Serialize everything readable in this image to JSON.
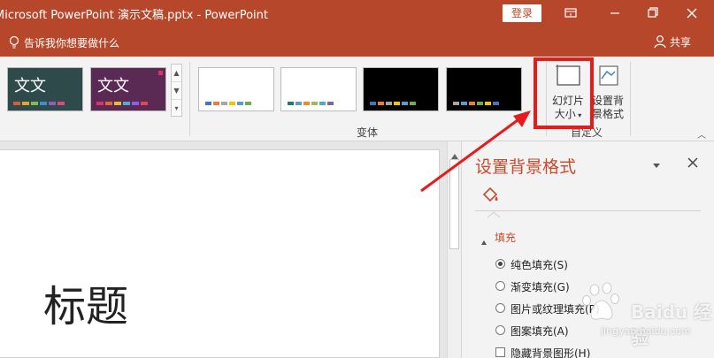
{
  "titlebar": {
    "title": "Microsoft PowerPoint 演示文稿.pptx  -  PowerPoint",
    "login_label": "登录",
    "background": "#b7472a"
  },
  "tellbar": {
    "tell_me": "告诉我你想要做什么",
    "share_label": "共享"
  },
  "ribbon": {
    "themes": [
      {
        "thumb_text": "文文",
        "bg": "#2f4a4a"
      },
      {
        "thumb_text": "文文",
        "bg": "#5a2a55"
      }
    ],
    "variants_group_label": "变体",
    "customize_group_label": "自定义",
    "slide_size": {
      "line1": "幻灯片",
      "line2": "大小"
    },
    "format_background": {
      "line1": "设置背",
      "line2": "景格式"
    }
  },
  "slide": {
    "title_placeholder": "标题"
  },
  "format_pane": {
    "title": "设置背景格式",
    "section": "填充",
    "options": [
      {
        "label": "纯色填充(S)",
        "type": "radio",
        "selected": true
      },
      {
        "label": "渐变填充(G)",
        "type": "radio",
        "selected": false
      },
      {
        "label": "图片或纹理填充(P)",
        "type": "radio",
        "selected": false
      },
      {
        "label": "图案填充(A)",
        "type": "radio",
        "selected": false
      },
      {
        "label": "隐藏背景图形(H)",
        "type": "checkbox",
        "selected": false
      }
    ]
  },
  "watermark": {
    "text": "Baidu 经验",
    "url": "jingyan.baidu.com"
  },
  "annotation": {
    "highlight_color": "#e51c1c"
  }
}
